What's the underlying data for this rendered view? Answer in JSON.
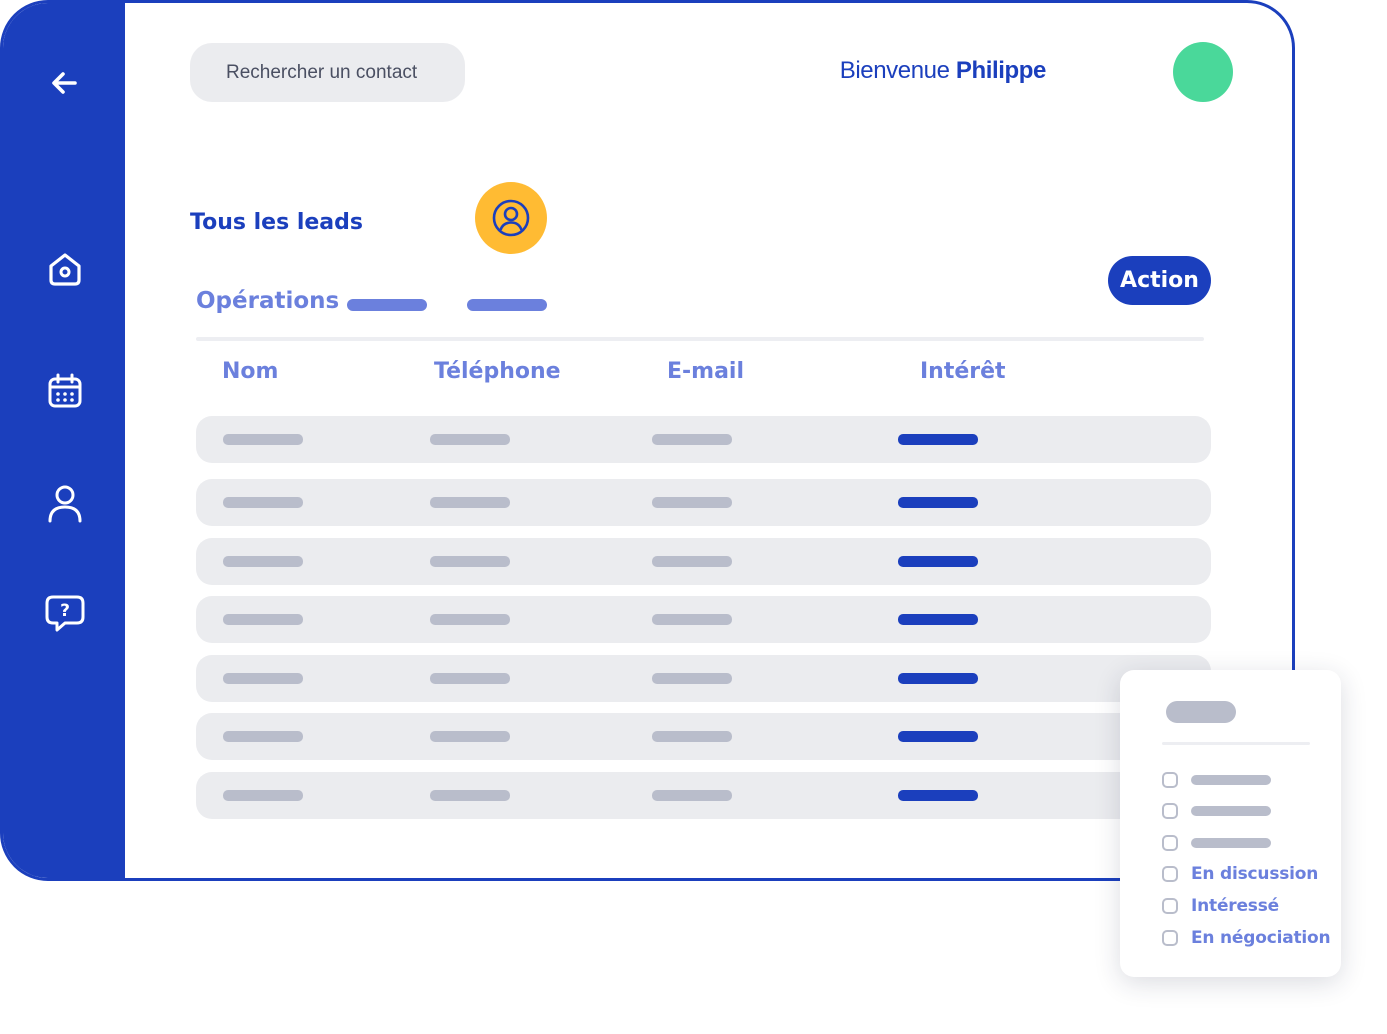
{
  "sidebar": {
    "items": [
      {
        "name": "back",
        "icon": "arrow-left-icon"
      },
      {
        "name": "home",
        "icon": "home-icon"
      },
      {
        "name": "calendar",
        "icon": "calendar-icon"
      },
      {
        "name": "contacts",
        "icon": "user-icon"
      },
      {
        "name": "help",
        "icon": "help-chat-icon"
      }
    ]
  },
  "header": {
    "search_placeholder": "Rechercher un contact",
    "welcome_prefix": "Bienvenue",
    "welcome_name": "Philippe"
  },
  "leads": {
    "title": "Tous les leads",
    "operations_label": "Opérations",
    "action_label": "Action"
  },
  "table": {
    "columns": [
      "Nom",
      "Téléphone",
      "E-mail",
      "Intérêt"
    ],
    "row_count": 7
  },
  "filter_popup": {
    "options": [
      "",
      "",
      "",
      "En discussion",
      "Intéressé",
      "En négociation"
    ]
  },
  "colors": {
    "primary": "#1b3fbd",
    "accent_green": "#4ad89a",
    "accent_yellow": "#ffbb33",
    "muted_blue": "#6b80dd",
    "row_bg": "#ebecef",
    "placeholder_bar": "#b9bdcb"
  }
}
